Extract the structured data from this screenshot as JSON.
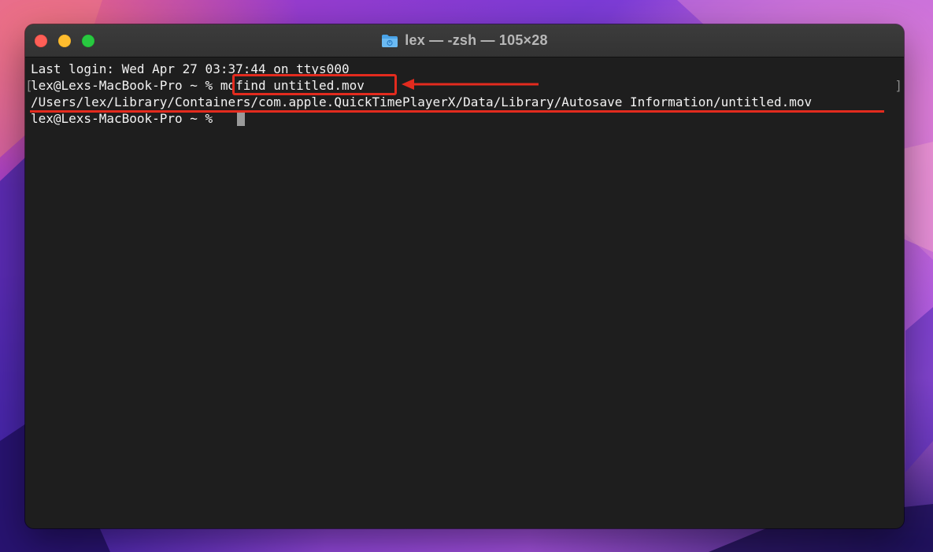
{
  "window": {
    "title": "lex — -zsh — 105×28"
  },
  "terminal": {
    "last_login": "Last login: Wed Apr 27 03:37:44 on ttys000",
    "prompt": "lex@Lexs-MacBook-Pro ~ % ",
    "command": "mdfind untitled.mov",
    "result_path": "/Users/lex/Library/Containers/com.apple.QuickTimePlayerX/Data/Library/Autosave Information/untitled.mov",
    "current_prompt": "lex@Lexs-MacBook-Pro ~ % ",
    "bracket_left": "[",
    "bracket_right": "]"
  },
  "annotations": {
    "highlight_color": "#e32b1e"
  },
  "icons": {
    "title_icon": "folder-icon"
  }
}
